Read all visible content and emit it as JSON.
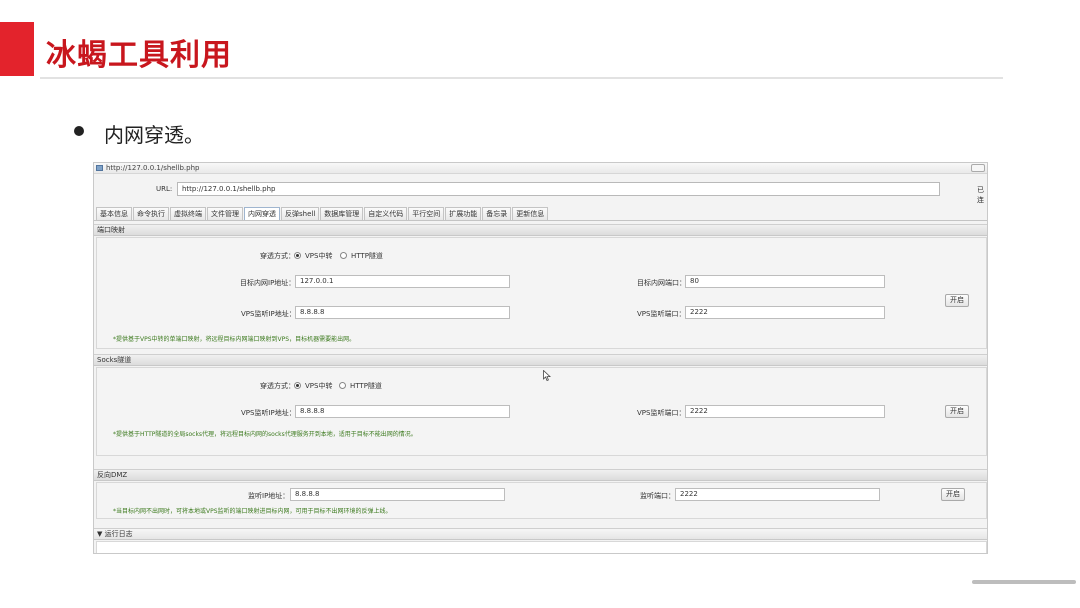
{
  "slide": {
    "title": "冰蝎工具利用",
    "bullet": "内网穿透。"
  },
  "window": {
    "title": "http://127.0.0.1/shellb.php"
  },
  "url_bar": {
    "label": "URL:",
    "value": "http://127.0.0.1/shellb.php",
    "side_label": "已连"
  },
  "tabs": [
    {
      "label": "基本信息"
    },
    {
      "label": "命令执行"
    },
    {
      "label": "虚拟终端"
    },
    {
      "label": "文件管理"
    },
    {
      "label": "内网穿透",
      "active": true
    },
    {
      "label": "反弹shell"
    },
    {
      "label": "数据库管理"
    },
    {
      "label": "自定义代码"
    },
    {
      "label": "平行空间"
    },
    {
      "label": "扩展功能"
    },
    {
      "label": "备忘录"
    },
    {
      "label": "更新信息"
    }
  ],
  "port_map": {
    "header": "端口映射",
    "mode_label": "穿透方式：",
    "mode_vps": "VPS中转",
    "mode_http": "HTTP隧道",
    "target_ip_label": "目标内网IP地址：",
    "target_ip_value": "127.0.0.1",
    "target_port_label": "目标内网端口：",
    "target_port_value": "80",
    "vps_ip_label": "VPS监听IP地址：",
    "vps_ip_value": "8.8.8.8",
    "vps_port_label": "VPS监听端口：",
    "vps_port_value": "2222",
    "start_label": "开启",
    "note": "*提供基于VPS中转的单端口映射，将远程目标内网端口映射到VPS，目标机器需要能出网。"
  },
  "socks": {
    "header": "Socks隧道",
    "mode_label": "穿透方式：",
    "mode_vps": "VPS中转",
    "mode_http": "HTTP隧道",
    "vps_ip_label": "VPS监听IP地址：",
    "vps_ip_value": "8.8.8.8",
    "vps_port_label": "VPS监听端口：",
    "vps_port_value": "2222",
    "start_label": "开启",
    "note": "*提供基于HTTP隧道的全局socks代理，将远程目标内网的socks代理服务开到本地，适用于目标不能出网的情况。"
  },
  "dmz": {
    "header": "反向DMZ",
    "ip_label": "监听IP地址：",
    "ip_value": "8.8.8.8",
    "port_label": "监听端口：",
    "port_value": "2222",
    "start_label": "开启",
    "note": "*当目标内网不出网时，可将本地或VPS监听的端口映射进目标内网，可用于目标不出网环境的反弹上线。"
  },
  "log": {
    "header": "▼ 运行日志"
  }
}
